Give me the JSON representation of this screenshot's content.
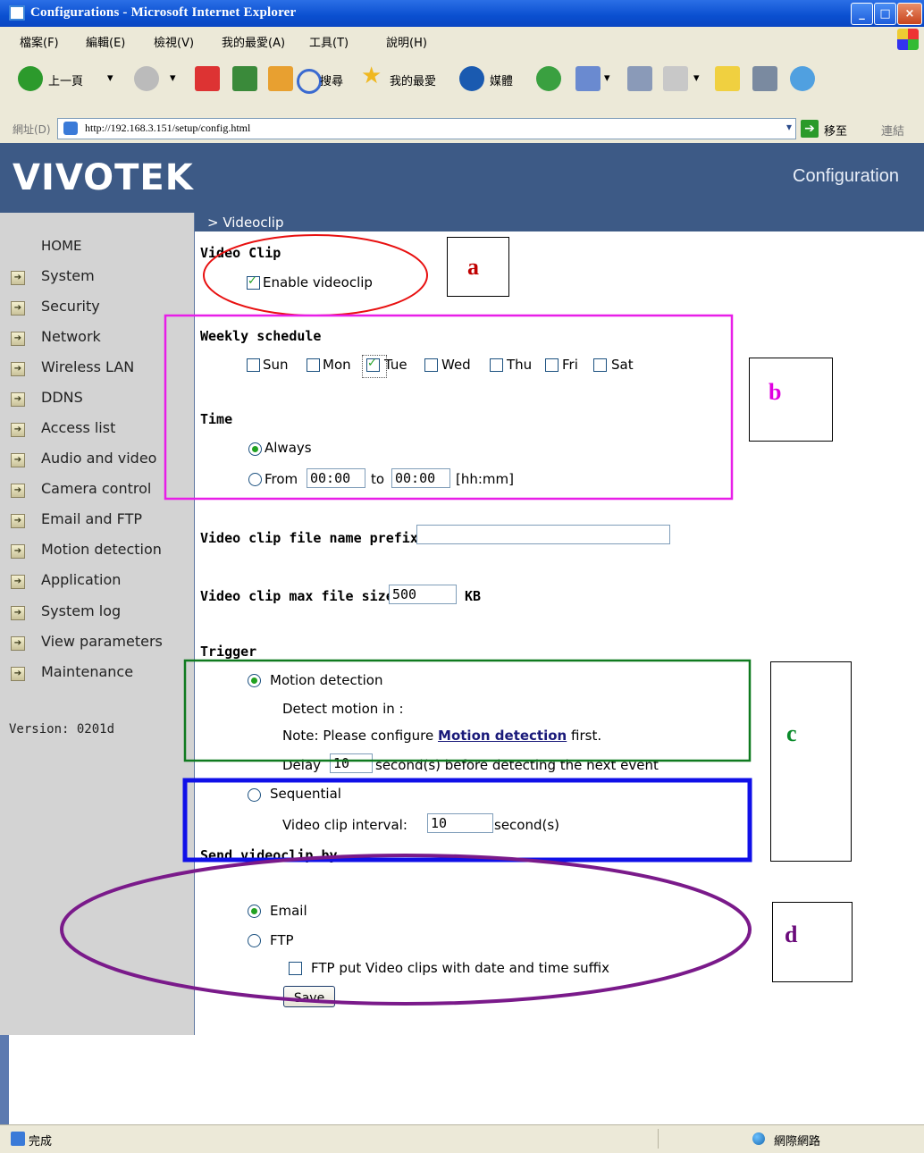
{
  "window": {
    "title": "Configurations - Microsoft Internet Explorer"
  },
  "menu": [
    "檔案(F)",
    "編輯(E)",
    "檢視(V)",
    "我的最愛(A)",
    "工具(T)",
    "說明(H)"
  ],
  "toolbar": {
    "back": "上一頁",
    "search": "搜尋",
    "favorites": "我的最愛",
    "media": "媒體"
  },
  "address": {
    "label": "網址(D)",
    "url": "http://192.168.3.151/setup/config.html",
    "go": "移至",
    "links": "連結"
  },
  "header": {
    "logo": "VIVOTEK",
    "title": "Configuration"
  },
  "breadcrumb": "> Videoclip",
  "sidebar": {
    "home": "HOME",
    "items": [
      "System",
      "Security",
      "Network",
      "Wireless LAN",
      "DDNS",
      "Access list",
      "Audio and video",
      "Camera control",
      "Email and FTP",
      "Motion detection",
      "Application",
      "System log",
      "View parameters",
      "Maintenance"
    ],
    "version": "Version: 0201d"
  },
  "videoclip": {
    "heading": "Video Clip",
    "enable_label": "Enable videoclip",
    "enabled": true
  },
  "schedule": {
    "heading": "Weekly schedule",
    "days": [
      {
        "label": "Sun",
        "checked": false
      },
      {
        "label": "Mon",
        "checked": false
      },
      {
        "label": "Tue",
        "checked": true
      },
      {
        "label": "Wed",
        "checked": false
      },
      {
        "label": "Thu",
        "checked": false
      },
      {
        "label": "Fri",
        "checked": false
      },
      {
        "label": "Sat",
        "checked": false
      }
    ]
  },
  "time": {
    "heading": "Time",
    "always_label": "Always",
    "from_label": "From",
    "to_label": "to",
    "from_value": "00:00",
    "to_value": "00:00",
    "format_hint": "[hh:mm]"
  },
  "prefix": {
    "label": "Video clip file name prefix",
    "value": ""
  },
  "maxsize": {
    "label": "Video clip max file size",
    "value": "500",
    "unit": "KB"
  },
  "trigger": {
    "heading": "Trigger",
    "motion_label": "Motion detection",
    "detect_in": "Detect motion in :",
    "note_pre": "Note: Please configure",
    "note_link": "Motion detection",
    "note_post": "first.",
    "delay_pre": "Delay",
    "delay_value": "10",
    "delay_post": "second(s) before detecting the next event",
    "sequential_label": "Sequential",
    "interval_label": "Video clip interval:",
    "interval_value": "10",
    "interval_unit": "second(s)"
  },
  "send": {
    "heading": "Send videoclip by",
    "email_label": "Email",
    "ftp_label": "FTP",
    "ftp_suffix_label": "FTP put Video clips with date and time suffix",
    "save_label": "Save"
  },
  "annotations": {
    "a": {
      "label": "a",
      "color": "#c00000"
    },
    "b": {
      "label": "b",
      "color": "#e000e0"
    },
    "c": {
      "label": "c",
      "color": "#0a8a2a"
    },
    "d": {
      "label": "d",
      "color": "#6a0a7a"
    }
  },
  "status": {
    "done": "完成",
    "zone": "網際網路"
  }
}
